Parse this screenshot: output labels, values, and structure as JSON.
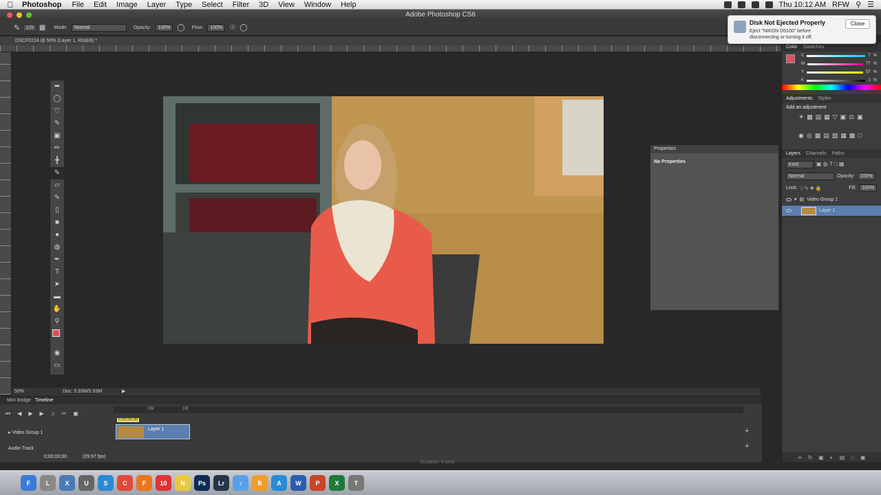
{
  "menubar": {
    "app": "Photoshop",
    "menus": [
      "File",
      "Edit",
      "Image",
      "Layer",
      "Type",
      "Select",
      "Filter",
      "3D",
      "View",
      "Window",
      "Help"
    ],
    "clock": "Thu 10:12 AM",
    "user": "RFW"
  },
  "window": {
    "title": "Adobe Photoshop CS6"
  },
  "options_bar": {
    "brush_size": "125",
    "mode_label": "Mode:",
    "mode_value": "Normal",
    "opacity_label": "Opacity:",
    "opacity_value": "100%",
    "flow_label": "Flow:",
    "flow_value": "100%"
  },
  "document": {
    "tab": "DSCF0224 @ 50% (Layer 1, RGB/8) *"
  },
  "properties_panel": {
    "title": "Properties",
    "content": "No Properties"
  },
  "notification": {
    "title": "Disk Not Ejected Properly",
    "body": "Eject \"NIKON D5100\" before disconnecting or turning it off.",
    "close_label": "Close"
  },
  "color_panel": {
    "tabs": [
      "Color",
      "Swatches"
    ],
    "channels": [
      {
        "label": "C",
        "value": "7"
      },
      {
        "label": "M",
        "value": "77"
      },
      {
        "label": "Y",
        "value": "57"
      },
      {
        "label": "K",
        "value": "1"
      }
    ],
    "pct": "%",
    "fg_color": "#d9525e"
  },
  "adjustments_panel": {
    "tabs": [
      "Adjustments",
      "Styles"
    ],
    "heading": "Add an adjustment"
  },
  "layers_panel": {
    "tabs": [
      "Layers",
      "Channels",
      "Paths"
    ],
    "kind": "Kind",
    "blend_mode": "Normal",
    "opacity_label": "Opacity:",
    "opacity_value": "100%",
    "lock_label": "Lock:",
    "fill_label": "Fill:",
    "fill_value": "100%",
    "layers": [
      {
        "name": "Video Group 1"
      },
      {
        "name": "Layer 1"
      }
    ]
  },
  "status_bar": {
    "zoom": "50%",
    "doc": "Doc: 5.93M/5.93M"
  },
  "timeline": {
    "tabs": [
      "Mini Bridge",
      "Timeline"
    ],
    "marks": [
      "05f",
      "10f"
    ],
    "current_time": "0;00;00;00",
    "track_group": "Video Group 1",
    "clip_label": "Layer 1",
    "audio_track": "Audio Track",
    "timecode": "0;00;00;00",
    "fps": "(29.97 fps)",
    "duration": "Duration: 4 secs"
  },
  "dock": {
    "apps": [
      {
        "name": "Finder",
        "label": "F",
        "color": "#3a7bd5"
      },
      {
        "name": "Launchpad",
        "label": "L",
        "color": "#888"
      },
      {
        "name": "Xcode",
        "label": "X",
        "color": "#4a7ab5"
      },
      {
        "name": "Utilities",
        "label": "U",
        "color": "#666"
      },
      {
        "name": "Safari",
        "label": "S",
        "color": "#2a8ad4"
      },
      {
        "name": "Chrome",
        "label": "C",
        "color": "#e04a3a"
      },
      {
        "name": "Firefox",
        "label": "F",
        "color": "#e8761e"
      },
      {
        "name": "Calendar",
        "label": "10",
        "color": "#d33"
      },
      {
        "name": "Notes",
        "label": "N",
        "color": "#e8c840"
      },
      {
        "name": "Photoshop",
        "label": "Ps",
        "color": "#0c2c55"
      },
      {
        "name": "Lightroom",
        "label": "Lr",
        "color": "#26364a"
      },
      {
        "name": "iTunes",
        "label": "♪",
        "color": "#5aa0e8"
      },
      {
        "name": "iBooks",
        "label": "B",
        "color": "#f09c2a"
      },
      {
        "name": "App Store",
        "label": "A",
        "color": "#2a8ad4"
      },
      {
        "name": "Word",
        "label": "W",
        "color": "#2a5db0"
      },
      {
        "name": "PowerPoint",
        "label": "P",
        "color": "#c8452a"
      },
      {
        "name": "Excel",
        "label": "X",
        "color": "#1f7a3a"
      },
      {
        "name": "Trash",
        "label": "T",
        "color": "#777"
      }
    ]
  }
}
